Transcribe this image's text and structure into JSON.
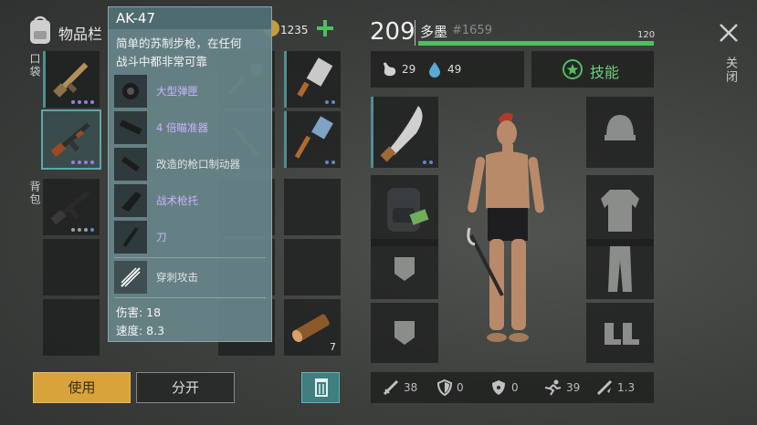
{
  "inventory": {
    "title": "物品栏",
    "pocket_label": "口袋",
    "backpack_label": "背包",
    "currency_value": "1235",
    "log_count": "7"
  },
  "tooltip": {
    "item_name": "AK-47",
    "description_line1": "简单的苏制步枪，在任何",
    "description_line2": "战斗中都非常可靠",
    "mods": [
      {
        "label": "大型弹匣",
        "icon": "magazine-icon"
      },
      {
        "label": "4 倍瞄准器",
        "icon": "scope-icon"
      },
      {
        "label": "改造的枪口制动器",
        "icon": "muzzle-brake-icon"
      },
      {
        "label": "战术枪托",
        "icon": "stock-icon"
      },
      {
        "label": "刀",
        "icon": "bayonet-icon"
      }
    ],
    "attack_label": "穿刺攻击",
    "damage": "伤害: 18",
    "speed": "速度: 8.3"
  },
  "actions": {
    "use_label": "使用",
    "split_label": "分开"
  },
  "player": {
    "level": "209",
    "name": "多墨",
    "id": "#1659",
    "hp": "120",
    "hp_fraction": 1.0,
    "food": "29",
    "water": "49",
    "skills_label": "技能",
    "close_label": "关闭"
  },
  "stats": {
    "attack": "38",
    "defense": "0",
    "radiation": "0",
    "speed": "39",
    "crit": "1.3"
  },
  "colors": {
    "accent": "#4fbf60",
    "use_button": "#d8a33a",
    "rarity_purple": "#9a7de0",
    "rarity_blue": "#5c89c6",
    "tooltip_bg": "#68858a"
  }
}
